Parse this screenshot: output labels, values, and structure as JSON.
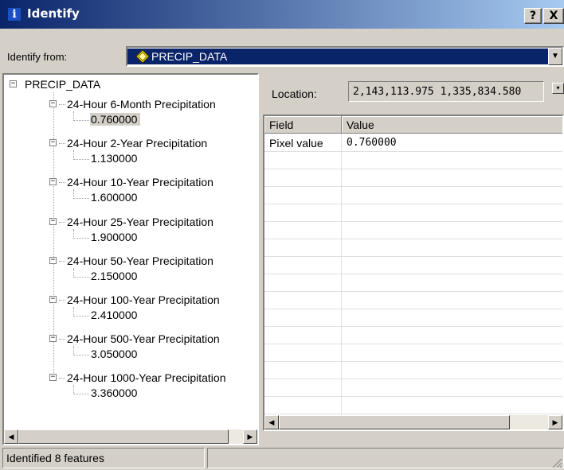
{
  "window": {
    "title": "Identify",
    "title_icon": "info-icon",
    "help_button": "?",
    "close_button": "X"
  },
  "identify_from": {
    "label": "Identify from:",
    "value": "PRECIP_DATA",
    "icon": "raster-layer-icon"
  },
  "tree": {
    "root_expander": "−",
    "root_label": "PRECIP_DATA",
    "nodes": [
      {
        "label": "24-Hour 6-Month Precipitation",
        "value": "0.760000",
        "selected": true
      },
      {
        "label": "24-Hour 2-Year Precipitation",
        "value": "1.130000"
      },
      {
        "label": "24-Hour 10-Year Precipitation",
        "value": "1.600000"
      },
      {
        "label": "24-Hour 25-Year Precipitation",
        "value": "1.900000"
      },
      {
        "label": "24-Hour 50-Year Precipitation",
        "value": "2.150000"
      },
      {
        "label": "24-Hour 100-Year Precipitation",
        "value": "2.410000"
      },
      {
        "label": "24-Hour 500-Year Precipitation",
        "value": "3.050000"
      },
      {
        "label": "24-Hour 1000-Year Precipitation",
        "value": "3.360000"
      }
    ]
  },
  "location": {
    "label": "Location:",
    "value": "2,143,113.975  1,335,834.580"
  },
  "grid": {
    "columns": [
      "Field",
      "Value"
    ],
    "rows": [
      {
        "field": "Pixel value",
        "value": "0.760000"
      }
    ]
  },
  "status": {
    "text": "Identified 8 features"
  },
  "colors": {
    "titlebar_start": "#0a246a",
    "titlebar_end": "#a6caf0",
    "face": "#d4d0c8",
    "selection": "#0a246a"
  }
}
